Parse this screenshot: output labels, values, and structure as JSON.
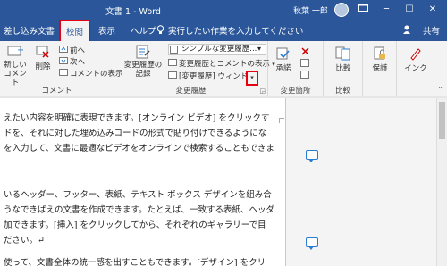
{
  "window": {
    "title": "文書 1 - Word",
    "user": "秋葉 一郎",
    "minimize": "─",
    "maximize": "☐",
    "close": "✕"
  },
  "tabs": [
    {
      "label": "差し込み文書",
      "active": false
    },
    {
      "label": "校閲",
      "active": true
    },
    {
      "label": "表示",
      "active": false
    },
    {
      "label": "ヘルプ",
      "active": false
    }
  ],
  "tell_me": "実行したい作業を入力してください",
  "share_label": "共有",
  "ribbon": {
    "comments": {
      "new_comment": "新しい\nコメント",
      "delete": "削除",
      "previous": "前へ",
      "next": "次へ",
      "show_comments": "コメントの表示",
      "group_label": "コメント"
    },
    "tracking": {
      "track_changes": "変更履歴の\n記録",
      "markup_select": "シンプルな変更履歴...",
      "show_markup": "変更履歴とコメントの表示",
      "reviewing_pane": "[変更履歴] ウィンドウ",
      "group_label": "変更履歴"
    },
    "changes": {
      "accept": "承諾",
      "group_label": "変更箇所"
    },
    "compare": {
      "compare": "比較",
      "group_label": "比較"
    },
    "protect": {
      "protect": "保護"
    },
    "ink": {
      "ink": "インク"
    }
  },
  "document": {
    "lines": [
      "えたい内容を明確に表現できます。[オンライン ビデオ] をクリックす",
      "ドを、それに対した埋め込みコードの形式で貼り付けできるようにな",
      "を入力して、文書に最適なビデオをオンラインで検索することもできま",
      "",
      "いるヘッダー、フッター、表紙、テキスト ボックス デザインを組み合",
      "うなできばえの文書を作成できます。たとえば、一致する表紙、ヘッダ",
      "加できます。[挿入] をクリックしてから、それぞれのギャラリーで目",
      "ださい。↵",
      "",
      "使って、文書全体の統一感を出すこともできます。[デザイン] をクリ"
    ]
  },
  "colors": {
    "brand": "#2b579a",
    "highlight": "#e60012",
    "comment_icon": "#2b7cd3"
  }
}
